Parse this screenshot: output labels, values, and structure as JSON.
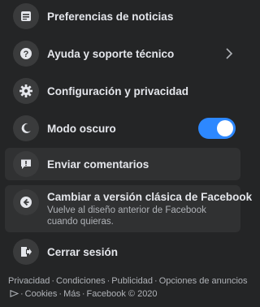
{
  "menu": {
    "items": [
      {
        "label": "Preferencias de noticias",
        "icon": "news-preferences-icon"
      },
      {
        "label": "Ayuda y soporte técnico",
        "icon": "help-icon"
      },
      {
        "label": "Configuración y privacidad",
        "icon": "gear-icon"
      },
      {
        "label": "Modo oscuro",
        "icon": "moon-icon",
        "toggle_on": true
      },
      {
        "label": "Enviar comentarios",
        "icon": "feedback-icon"
      },
      {
        "label": "Cambiar a versión clásica de Facebook",
        "sublabel": "Vuelve al diseño anterior de Facebook cuando quieras.",
        "icon": "back-arrow-icon"
      },
      {
        "label": "Cerrar sesión",
        "icon": "logout-icon"
      }
    ]
  },
  "footer": {
    "links": [
      "Privacidad",
      "Condiciones",
      "Publicidad",
      "Opciones de anuncios",
      "Cookies",
      "Más",
      "Facebook © 2020"
    ],
    "separator": "·"
  },
  "colors": {
    "background": "#242526",
    "row_highlight": "#303132",
    "icon_bg": "#3a3b3c",
    "text_primary": "#e4e6eb",
    "text_secondary": "#b0b3b8",
    "toggle_on": "#2d88ff"
  }
}
